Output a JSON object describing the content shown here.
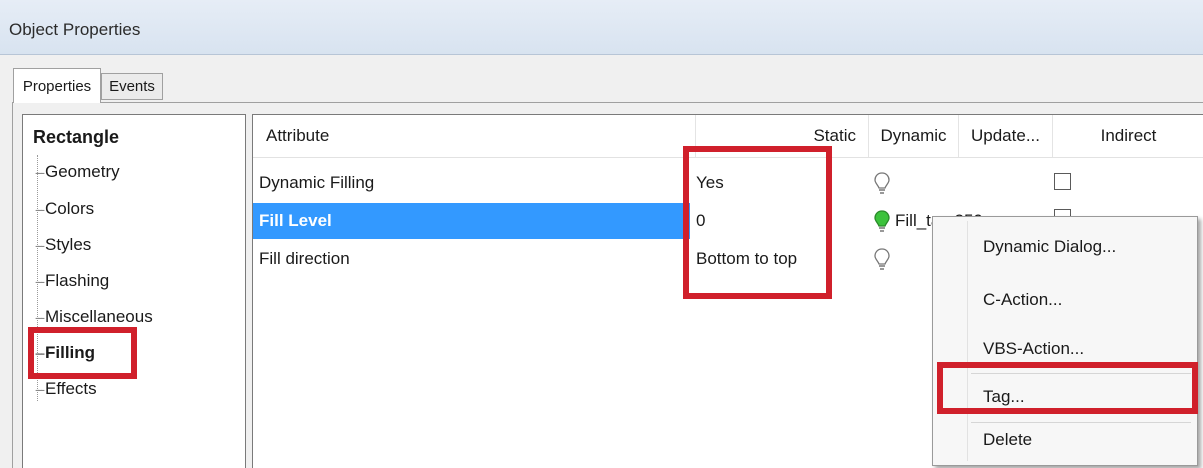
{
  "window": {
    "title": "Object Properties"
  },
  "tabs": [
    {
      "label": "Properties",
      "active": true
    },
    {
      "label": "Events",
      "active": false
    }
  ],
  "tree": {
    "root": "Rectangle",
    "items": [
      "Geometry",
      "Colors",
      "Styles",
      "Flashing",
      "Miscellaneous",
      "Filling",
      "Effects"
    ],
    "selected": "Filling"
  },
  "grid": {
    "columns": [
      "Attribute",
      "Static",
      "Dynamic",
      "Update...",
      "Indirect"
    ],
    "rows": [
      {
        "attribute": "Dynamic Filling",
        "static": "Yes",
        "dynamic": "",
        "dynamic_icon": "lightbulb-off-icon",
        "update": "",
        "indirect": false
      },
      {
        "attribute": "Fill Level",
        "static": "0",
        "dynamic": "Fill_tag 250 ms",
        "dynamic_icon": "lightbulb-green-icon",
        "update": "",
        "indirect": false
      },
      {
        "attribute": "Fill direction",
        "static": "Bottom to top",
        "dynamic": "",
        "dynamic_icon": "lightbulb-off-icon",
        "update": "",
        "indirect": false
      }
    ],
    "selected_row": "Fill Level"
  },
  "context_menu": {
    "items": [
      "Dynamic Dialog...",
      "C-Action...",
      "VBS-Action...",
      "Tag...",
      "Delete"
    ],
    "highlighted": "Tag..."
  },
  "colors": {
    "selection": "#3399ff",
    "annotation_red": "#d0202b",
    "bulb_green": "#3cc23c"
  }
}
